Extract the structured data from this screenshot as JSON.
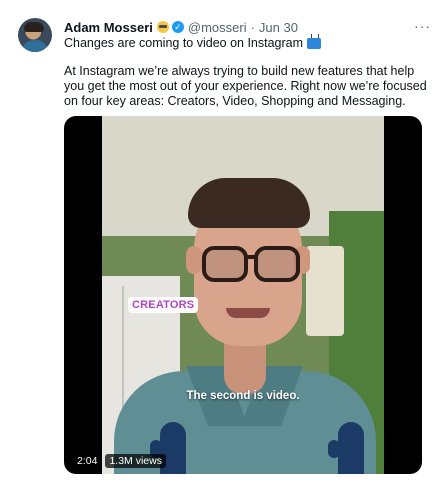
{
  "tweet": {
    "author_name": "Adam Mosseri",
    "author_handle": "@mosseri",
    "separator": "·",
    "date": "Jun 30",
    "more_icon": "···",
    "line1": "Changes are coming to video on Instagram",
    "body": "At Instagram we’re always trying to build new features that help you get the most out of your experience. Right now we’re focused on four key areas: Creators, Video, Shopping and Messaging."
  },
  "media": {
    "sticker_text": "CREATORS",
    "caption": "The second is video.",
    "duration": "2:04",
    "views": "1.3M views"
  },
  "colors": {
    "verified": "#1d9bf0",
    "secondary_text": "#536471",
    "sticker_text": "#b245c5"
  },
  "icons": [
    "avatar",
    "sunglasses-emoji-icon",
    "verified-badge-icon",
    "more-icon",
    "tv-emoji-icon"
  ]
}
